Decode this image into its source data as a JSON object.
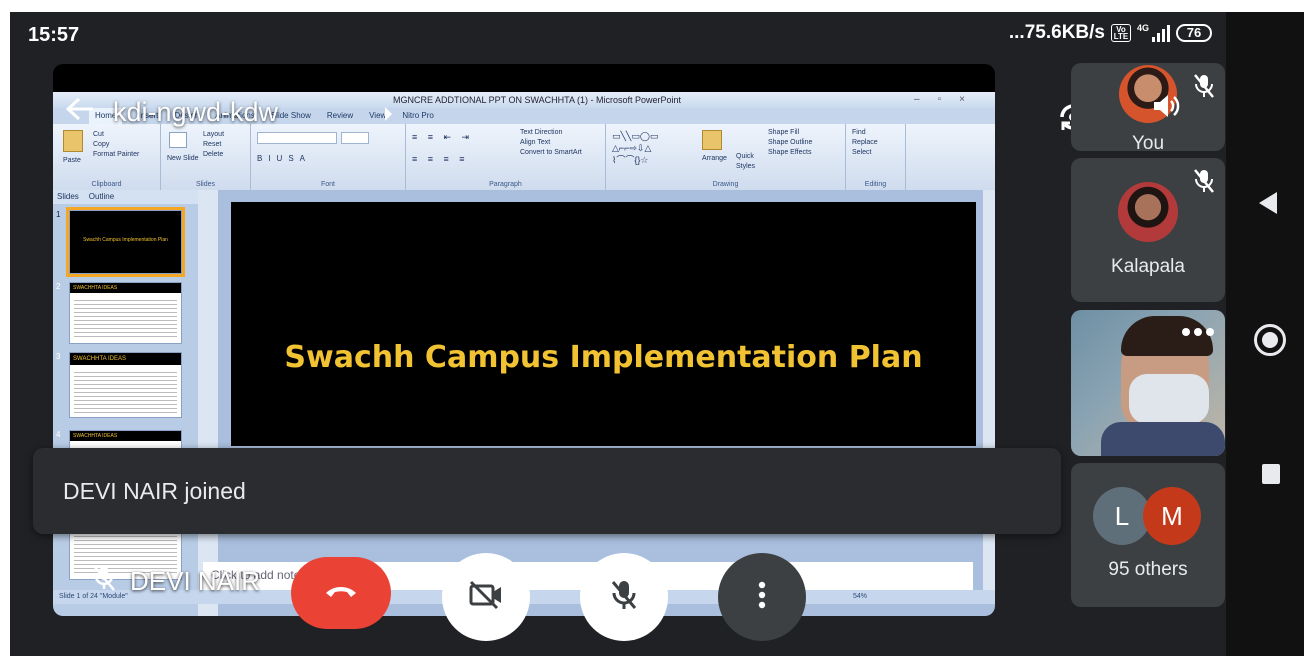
{
  "status_bar": {
    "time": "15:57",
    "network_speed": "...75.6KB/s",
    "volte_label": "Vo LTE",
    "network_type": "4G",
    "battery": "76"
  },
  "meeting": {
    "code": "kdi-ngwd-kdw",
    "presenter_name": "DEVI NAIR"
  },
  "powerpoint": {
    "window_title": "MGNCRE ADDTIONAL PPT ON SWACHHTA (1) - Microsoft PowerPoint",
    "tabs": [
      "Home",
      "Insert",
      "Design",
      "Animations",
      "Slide Show",
      "Review",
      "View",
      "Nitro Pro"
    ],
    "ribbon_groups": [
      "Clipboard",
      "Slides",
      "Font",
      "Paragraph",
      "Drawing",
      "Editing"
    ],
    "clipboard_items": [
      "Cut",
      "Copy",
      "Format Painter"
    ],
    "paste_label": "Paste",
    "slides_items": [
      "Layout",
      "Reset",
      "Delete"
    ],
    "new_slide_label": "New Slide",
    "paragraph_items": [
      "Text Direction",
      "Align Text",
      "Convert to SmartArt"
    ],
    "drawing_items": [
      "Shape Fill",
      "Shape Outline",
      "Shape Effects"
    ],
    "arrange_label": "Arrange",
    "quick_styles_label": "Quick Styles",
    "editing_items": [
      "Find",
      "Replace",
      "Select"
    ],
    "pane_tabs": [
      "Slides",
      "Outline"
    ],
    "thumbnails": [
      {
        "num": "1",
        "title": "Swachh Campus Implementation Plan"
      },
      {
        "num": "2",
        "title": "SWACHHTA IDEAS"
      },
      {
        "num": "3",
        "title": "SWACHHTA IDEAS"
      },
      {
        "num": "4",
        "title": "SWACHHTA IDEAS"
      }
    ],
    "slide_title": "Swachh Campus Implementation Plan",
    "notes_placeholder": "Click to add notes",
    "status_text": "Slide 1 of 24   \"Module\"",
    "zoom": "54%"
  },
  "toast": {
    "message": "DEVI NAIR joined"
  },
  "participants": {
    "self_label": "You",
    "participant_2": "Kalapala",
    "others_letters": [
      "L",
      "M"
    ],
    "others_label": "95 others"
  },
  "colors": {
    "end_call": "#ea4335",
    "tile_bg": "#3c4043",
    "slide_title": "#f1c232",
    "letter_l": "#5f6f7a",
    "letter_m": "#c5391b"
  }
}
